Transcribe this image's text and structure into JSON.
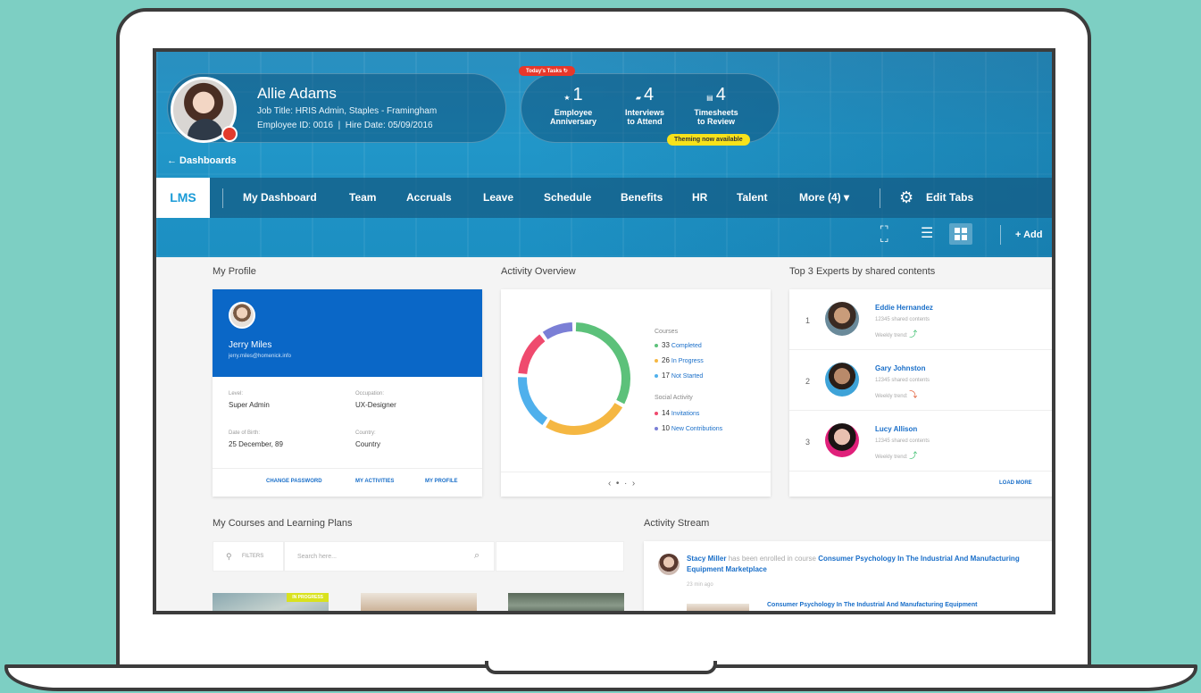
{
  "profile": {
    "name": "Allie Adams",
    "job_title": "Job Title: HRIS Admin, Staples - Framingham",
    "employee_line": "Employee ID: 0016  |  Hire Date: 05/09/2016"
  },
  "tasks": {
    "tag": "Today's Tasks",
    "items": [
      {
        "icon": "star-icon",
        "count": "1",
        "label_1": "Employee",
        "label_2": "Anniversary"
      },
      {
        "icon": "chat-icon",
        "count": "4",
        "label_1": "Interviews",
        "label_2": "to Attend"
      },
      {
        "icon": "timesheet-icon",
        "count": "4",
        "label_1": "Timesheets",
        "label_2": "to Review"
      }
    ],
    "theme_badge": "Theming now available"
  },
  "back_link": "← Dashboards",
  "nav": {
    "brand": "LMS",
    "items": [
      "My Dashboard",
      "Team",
      "Accruals",
      "Leave",
      "Schedule",
      "Benefits",
      "HR",
      "Talent",
      "More (4) ▾"
    ],
    "edit_tabs": "Edit Tabs"
  },
  "toolbar": {
    "add": "+ Add"
  },
  "my_profile": {
    "title": "My Profile",
    "name": "Jerry Miles",
    "email": "jerry.miles@homenick.info",
    "fields": [
      {
        "label": "Level:",
        "value": "Super Admin"
      },
      {
        "label": "Occupation:",
        "value": "UX-Designer"
      },
      {
        "label": "Date of Birth:",
        "value": "25 December, 89"
      },
      {
        "label": "Country:",
        "value": "Country"
      }
    ],
    "links": [
      "CHANGE PASSWORD",
      "MY ACTIVITIES",
      "MY PROFILE"
    ]
  },
  "activity": {
    "title": "Activity Overview",
    "courses_heading": "Courses",
    "courses": [
      {
        "count": "33",
        "label": "Completed",
        "color": "#5cc17a"
      },
      {
        "count": "26",
        "label": "In Progress",
        "color": "#f5b742"
      },
      {
        "count": "17",
        "label": "Not Started",
        "color": "#4fb0ec"
      }
    ],
    "social_heading": "Social Activity",
    "social": [
      {
        "count": "14",
        "label": "Invitations",
        "color": "#ef4a6e"
      },
      {
        "count": "10",
        "label": "New Contributions",
        "color": "#7b7fd6"
      }
    ],
    "pager": "‹  •  ·  ›"
  },
  "chart_data": {
    "type": "pie",
    "labels": [
      "Completed",
      "In Progress",
      "Not Started",
      "Invitations",
      "New Contributions"
    ],
    "values": [
      33,
      26,
      17,
      14,
      10
    ],
    "colors": [
      "#5cc17a",
      "#f5b742",
      "#4fb0ec",
      "#ef4a6e",
      "#7b7fd6"
    ]
  },
  "experts": {
    "title": "Top 3 Experts by shared contents",
    "items": [
      {
        "rank": "1",
        "name": "Eddie Hernandez",
        "shared": "12345 shared contents",
        "trend": "Weekly trend:",
        "trend_color": "#3cbf6e"
      },
      {
        "rank": "2",
        "name": "Gary Johnston",
        "shared": "12345 shared contents",
        "trend": "Weekly trend:",
        "trend_color": "#e0542d"
      },
      {
        "rank": "3",
        "name": "Lucy Allison",
        "shared": "12345 shared contents",
        "trend": "Weekly trend:",
        "trend_color": "#3cbf6e"
      }
    ],
    "load_more": "LOAD MORE"
  },
  "courses": {
    "title": "My Courses and Learning Plans",
    "filters": "FILTERS",
    "search_placeholder": "Search here...",
    "badge": "IN PROGRESS"
  },
  "stream": {
    "title": "Activity Stream",
    "user": "Stacy Miller",
    "action": " has been enrolled in course ",
    "course": "Consumer Psychology In The Industrial And Manufacturing Equipment Marketplace",
    "time": "23 min ago",
    "preview": "Consumer Psychology In The Industrial And Manufacturing Equipment"
  }
}
